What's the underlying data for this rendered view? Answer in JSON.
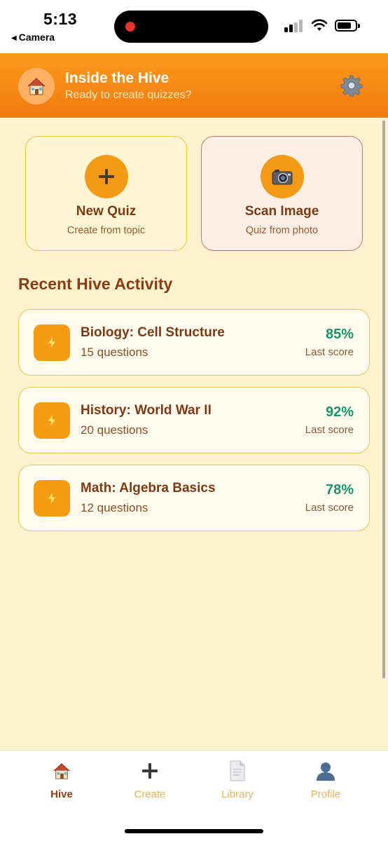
{
  "status_bar": {
    "time": "5:13",
    "back_label": "Camera",
    "recording_color": "#e8322b"
  },
  "header": {
    "title": "Inside the Hive",
    "subtitle": "Ready to create quizzes?",
    "avatar_icon": "house-icon",
    "settings_icon": "gear-icon"
  },
  "actions": [
    {
      "title": "New Quiz",
      "subtitle": "Create from topic",
      "icon": "plus-icon"
    },
    {
      "title": "Scan Image",
      "subtitle": "Quiz from photo",
      "icon": "camera-icon"
    }
  ],
  "recent": {
    "heading": "Recent Hive Activity",
    "items": [
      {
        "title": "Biology: Cell Structure",
        "questions": "15 questions",
        "score": "85%",
        "score_label": "Last score",
        "icon": "lightning-icon"
      },
      {
        "title": "History: World War II",
        "questions": "20 questions",
        "score": "92%",
        "score_label": "Last score",
        "icon": "lightning-icon"
      },
      {
        "title": "Math: Algebra Basics",
        "questions": "12 questions",
        "score": "78%",
        "score_label": "Last score",
        "icon": "lightning-icon"
      }
    ]
  },
  "tabs": [
    {
      "label": "Hive",
      "icon": "house-icon",
      "active": true
    },
    {
      "label": "Create",
      "icon": "plus-icon",
      "active": false
    },
    {
      "label": "Library",
      "icon": "document-icon",
      "active": false
    },
    {
      "label": "Profile",
      "icon": "person-icon",
      "active": false
    }
  ],
  "colors": {
    "header_start": "#fb9a1c",
    "header_end": "#f27a0e",
    "background": "#fff3cf",
    "accent": "#f59a15",
    "score_green": "#19936b",
    "text_brown": "#7d3a12"
  }
}
